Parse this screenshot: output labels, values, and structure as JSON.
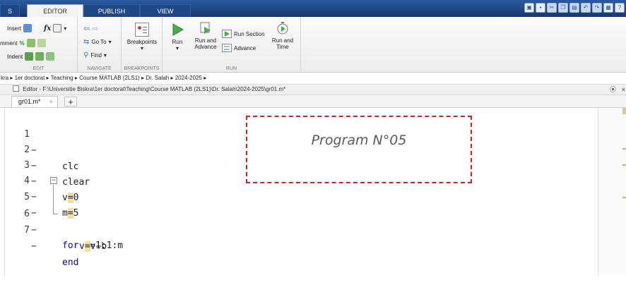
{
  "tabs": [
    {
      "label": "S"
    },
    {
      "label": "EDITOR"
    },
    {
      "label": "PUBLISH"
    },
    {
      "label": "VIEW"
    }
  ],
  "ribbon": {
    "edit": {
      "insert_label": "Insert",
      "fx_label": "fx",
      "comment_label": "mment",
      "comment_pct": "%",
      "indent_label": "Indent",
      "section_label": "EDIT"
    },
    "navigate": {
      "goto_label": "Go To",
      "find_label": "Find",
      "section_label": "NAVIGATE"
    },
    "breakpoints": {
      "label": "Breakpoints",
      "section_label": "BREAKPOINTS"
    },
    "run": {
      "run_label": "Run",
      "run_advance_label": "Run and Advance",
      "run_section_label": "Run Section",
      "advance_label": "Advance",
      "run_time_label": "Run and Time",
      "section_label": "RUN"
    }
  },
  "breadcrumb": [
    "kra",
    "1er doctorat",
    "Teaching",
    "Course MATLAB (2LS1)",
    "Dr. Salah",
    "2024-2025"
  ],
  "editor": {
    "title": "Editor - F:\\Universitie Biskra\\1er doctorat\\Teaching\\Course MATLAB (2LS1)\\Dr. Salah\\2024-2025\\gr01.m*",
    "file_tab": "gr01.m*",
    "close_glyph": "×",
    "add_tab": "+",
    "dash": "−",
    "lines": [
      {
        "num": "1",
        "text": "clc"
      },
      {
        "num": "2",
        "text": "clear"
      },
      {
        "num": "3",
        "pre": "v",
        "hl": "=",
        "post": "0"
      },
      {
        "num": "4",
        "pre": "m",
        "hl": "=",
        "post": "5"
      },
      {
        "num": "5",
        "kw": "for",
        "post": " b=1:1:m"
      },
      {
        "num": "6",
        "pre": "v",
        "hl": "=",
        "post": "v+b"
      },
      {
        "num": "7",
        "kw": "end"
      }
    ]
  },
  "callout": {
    "text": "Program N°05"
  },
  "colors": {
    "keyword": "#0000ff",
    "callout_border": "#d42020",
    "highlight": "#f3df9f"
  }
}
